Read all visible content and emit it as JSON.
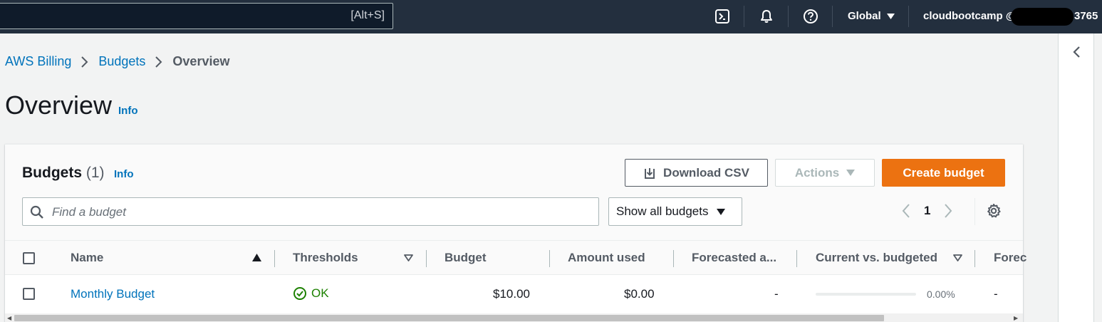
{
  "topnav": {
    "search_shortcut": "[Alt+S]",
    "region": "Global",
    "account_prefix": "cloudbootcamp @",
    "account_suffix": "3765",
    "icons": [
      "cloudshell-icon",
      "bell-icon",
      "help-icon",
      "caret-down-icon"
    ]
  },
  "breadcrumb": {
    "items": [
      "AWS Billing",
      "Budgets",
      "Overview"
    ]
  },
  "page": {
    "title": "Overview",
    "info": "Info"
  },
  "budgets_panel": {
    "title": "Budgets",
    "count": "(1)",
    "info": "Info",
    "download_label": "Download CSV",
    "actions_label": "Actions",
    "create_label": "Create budget",
    "find_placeholder": "Find a budget",
    "filter_value": "Show all budgets",
    "current_page": "1"
  },
  "table": {
    "columns": [
      "Name",
      "Thresholds",
      "Budget",
      "Amount used",
      "Forecasted a...",
      "Current vs. budgeted",
      "Forec"
    ],
    "rows": [
      {
        "name": "Monthly Budget",
        "threshold": "OK",
        "budget": "$10.00",
        "amount_used": "$0.00",
        "forecasted": "-",
        "current_vs_budgeted": "0.00%",
        "current_vs_budgeted_fraction": 0.0,
        "forecasted_vs_budgeted": "-"
      }
    ]
  },
  "colors": {
    "nav_bg": "#232f3e",
    "link": "#0073bb",
    "primary": "#ec7211",
    "success": "#1d8102"
  },
  "scroll": {
    "horizontal_position_fraction": 0.0,
    "horizontal_visible_fraction": 0.87
  }
}
